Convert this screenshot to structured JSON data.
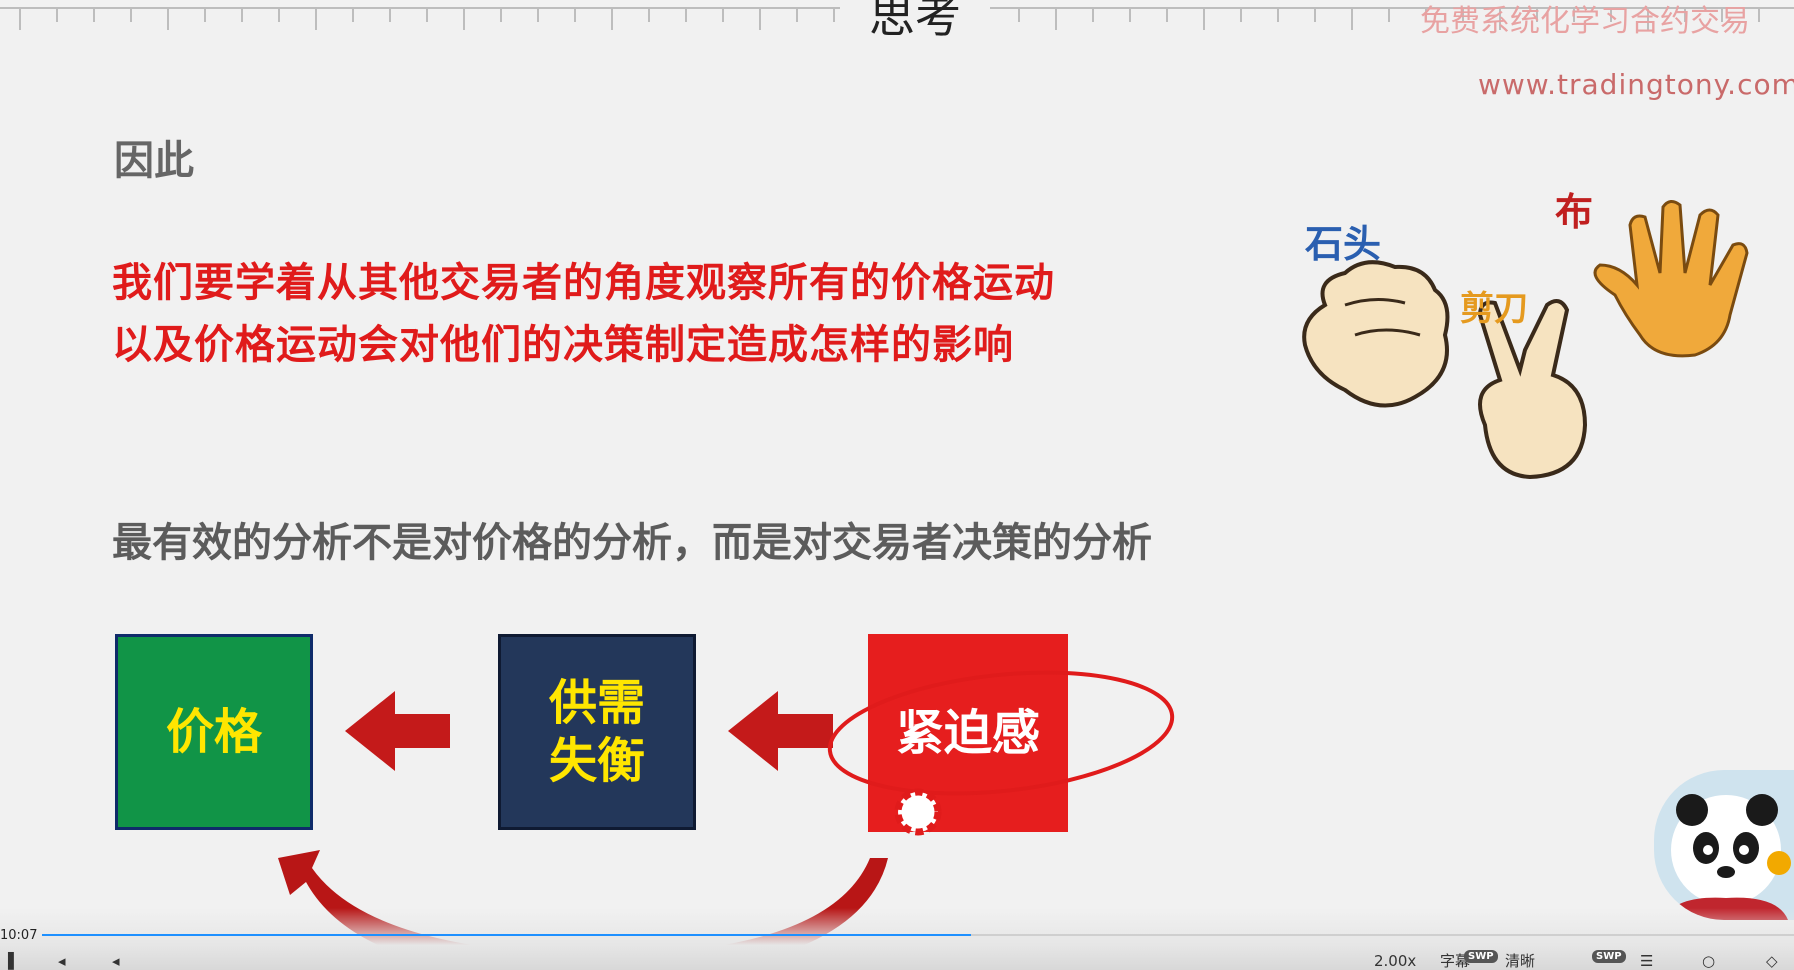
{
  "slide": {
    "title": "思考",
    "promo_text": "免费系统化学习合约交易",
    "promo_url": "www.tradingtony.com",
    "heading": "因此",
    "red_line_1": "我们要学着从其他交易者的角度观察所有的价格运动",
    "red_line_2": "以及价格运动会对他们的决策制定造成怎样的影响",
    "gray_line": "最有效的分析不是对价格的分析，而是对交易者决策的分析",
    "boxes": {
      "price": "价格",
      "supply_demand_line1": "供需",
      "supply_demand_line2": "失衡",
      "urgency": "紧迫感"
    },
    "illustration": {
      "rock_label": "石头",
      "scissors_label": "剪刀",
      "paper_label": "布"
    }
  },
  "player": {
    "current_time": "10:07",
    "progress": 0.53,
    "controls": [
      "2.00x",
      "字幕",
      "清晰"
    ],
    "swp_badge": "SWP",
    "colors": {
      "progress": "#1e90ff"
    }
  },
  "colors": {
    "red_text": "#e01b1b",
    "green_box": "#119447",
    "navy_box": "#23375a",
    "red_box": "#e61e1e",
    "box_text": "#ffe600",
    "arrow": "#c41a1a"
  }
}
